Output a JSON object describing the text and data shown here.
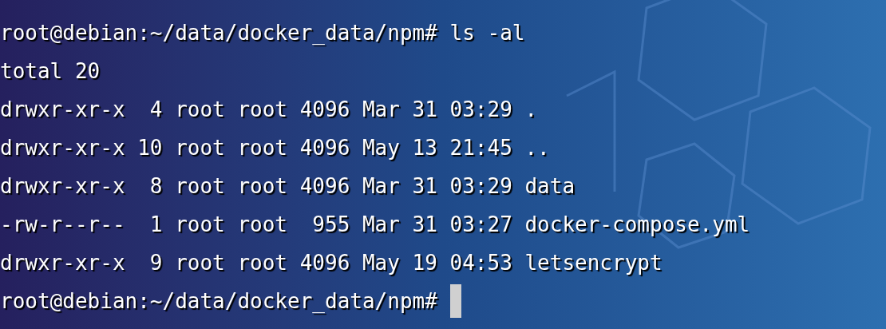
{
  "terminal": {
    "lines": [
      {
        "kind": "command",
        "prompt": "root@debian:~/data/docker_data/npm#",
        "command": "ls -al"
      },
      {
        "kind": "output",
        "text": "total 20"
      },
      {
        "kind": "output",
        "text": "drwxr-xr-x  4 root root 4096 Mar 31 03:29 ."
      },
      {
        "kind": "output",
        "text": "drwxr-xr-x 10 root root 4096 May 13 21:45 .."
      },
      {
        "kind": "output",
        "text": "drwxr-xr-x  8 root root 4096 Mar 31 03:29 data"
      },
      {
        "kind": "output",
        "text": "-rw-r--r--  1 root root  955 Mar 31 03:27 docker-compose.yml"
      },
      {
        "kind": "output",
        "text": "drwxr-xr-x  9 root root 4096 May 19 04:53 letsencrypt"
      },
      {
        "kind": "prompt",
        "prompt": "root@debian:~/data/docker_data/npm#",
        "cursor": true
      }
    ]
  }
}
